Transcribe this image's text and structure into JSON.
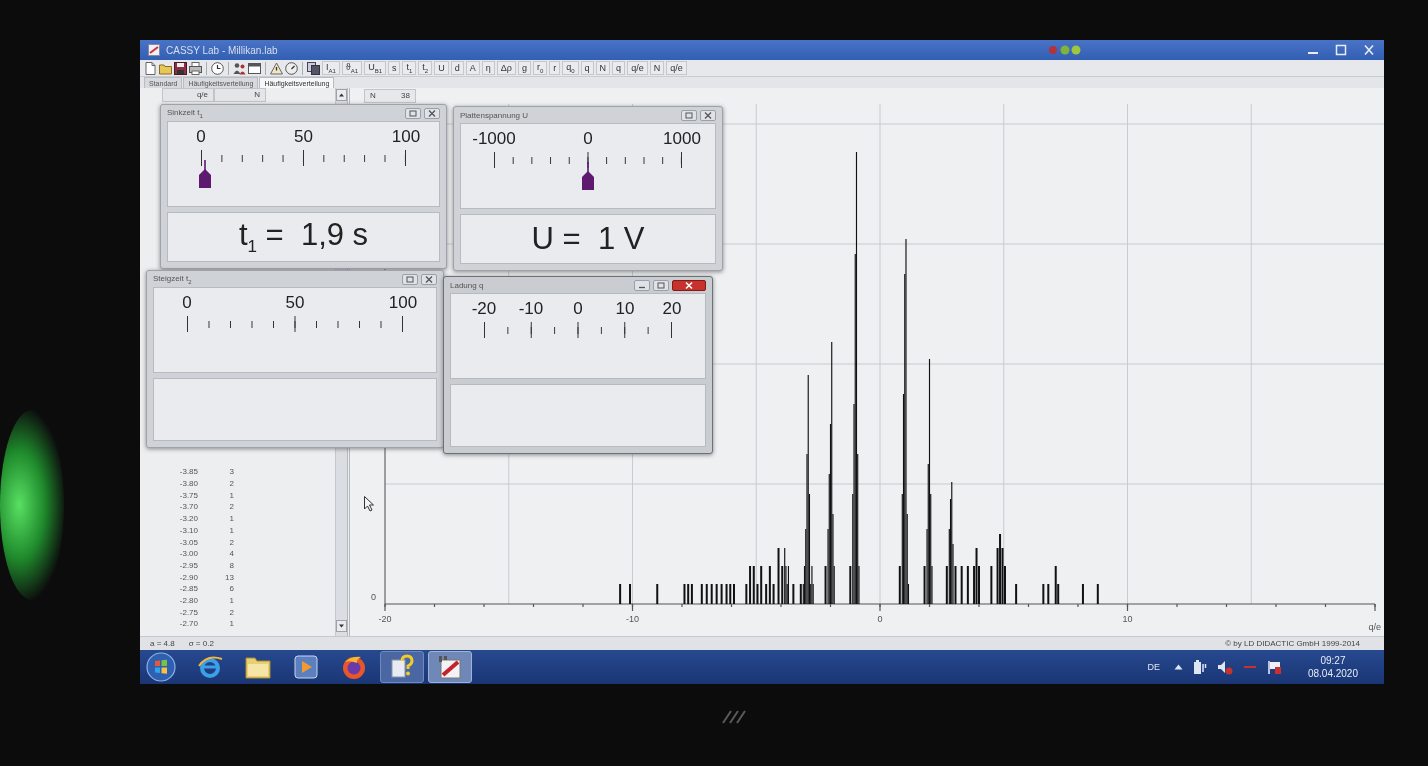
{
  "window": {
    "title": "CASSY Lab - Millikan.lab"
  },
  "toolbar": {
    "buttons": [
      "I$_{A1}$",
      "ϑ$_{A1}$",
      "U$_{B1}$",
      "s",
      "t$_{1}$",
      "t$_{2}$",
      "U",
      "d",
      "A",
      "η",
      "Δρ",
      "g",
      "r$_{0}$",
      "r",
      "q$_{0}$",
      "q",
      "N",
      "q",
      "q/e",
      "N",
      "q/e"
    ]
  },
  "tabs": [
    {
      "label": "Standard",
      "selected": false
    },
    {
      "label": "Häufigkeitsverteilung",
      "selected": false
    },
    {
      "label": "Häufigkeitsverteilung",
      "selected": true
    }
  ],
  "table": {
    "columns": [
      "q/e",
      "N"
    ],
    "rows": [
      [
        "-3.85",
        "3"
      ],
      [
        "-3.80",
        "2"
      ],
      [
        "-3.75",
        "1"
      ],
      [
        "-3.70",
        "2"
      ],
      [
        "-3.20",
        "1"
      ],
      [
        "-3.10",
        "1"
      ],
      [
        "-3.05",
        "2"
      ],
      [
        "-3.00",
        "4"
      ],
      [
        "-2.95",
        "8"
      ],
      [
        "-2.90",
        "13"
      ],
      [
        "-2.85",
        "6"
      ],
      [
        "-2.80",
        "1"
      ],
      [
        "-2.75",
        "2"
      ],
      [
        "-2.70",
        "1"
      ]
    ]
  },
  "chart": {
    "header": {
      "label": "N",
      "value": "38"
    },
    "x_ticks": [
      "-20",
      "-10",
      "0",
      "10"
    ],
    "y_ticks": [
      "0"
    ],
    "x_label": "q/e"
  },
  "meters": [
    {
      "title": "Sinkzeit t$_{1}$",
      "active": false,
      "scale": [
        "0",
        "50",
        "100"
      ],
      "level": 0.019,
      "reading": "t$_{1}$ =  1,9 s"
    },
    {
      "title": "Plattenspannung U",
      "active": false,
      "scale": [
        "-1000",
        "0",
        "1000"
      ],
      "level": 0.5,
      "reading": "U =  1 V"
    },
    {
      "title": "Steigzeit t$_{2}$",
      "active": false,
      "scale": [
        "0",
        "50",
        "100"
      ]
    },
    {
      "title": "Ladung q",
      "active": true,
      "scale": [
        "-20",
        "-10",
        "0",
        "10",
        "20"
      ]
    }
  ],
  "status_bar": {
    "readings": [
      "a = 4.8",
      "σ = 0.2"
    ],
    "copyright": "© by LD DIDACTIC GmbH 1999-2014"
  },
  "taskbar": {
    "items": [
      {
        "kind": "ring",
        "open": false,
        "selected": false
      },
      {
        "kind": "folder",
        "open": false,
        "selected": false
      },
      {
        "kind": "player",
        "open": false,
        "selected": false
      },
      {
        "kind": "globe",
        "open": false,
        "selected": false
      },
      {
        "kind": "help",
        "open": true,
        "selected": false
      },
      {
        "kind": "app",
        "open": true,
        "selected": true
      }
    ],
    "tray": {
      "language": "DE",
      "time": "09:27",
      "date": "08.04.2020"
    }
  }
}
